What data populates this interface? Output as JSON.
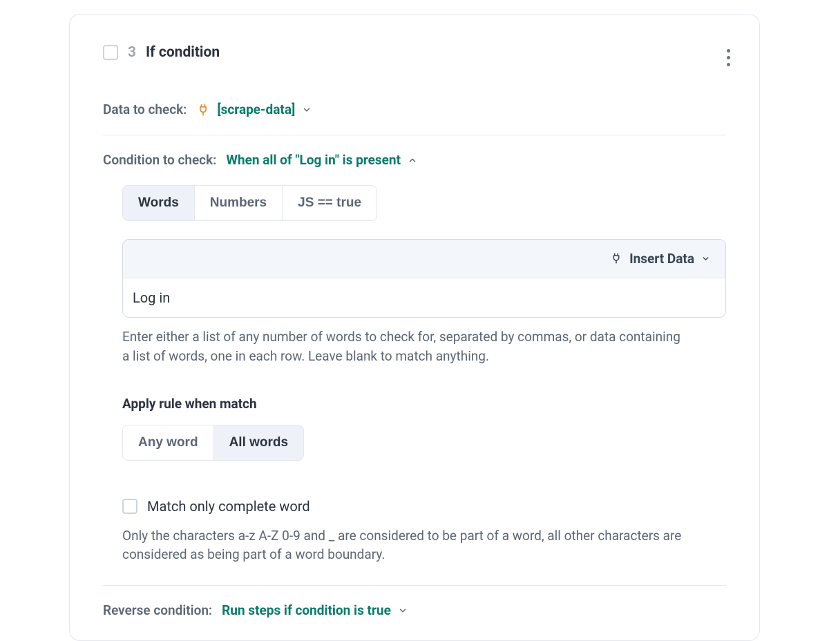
{
  "step": {
    "number": "3",
    "title": "If condition"
  },
  "data_to_check": {
    "label": "Data to check:",
    "value": "[scrape-data]"
  },
  "condition_to_check": {
    "label": "Condition to check:",
    "value": "When all of \"Log in\" is present"
  },
  "tabs": {
    "words": "Words",
    "numbers": "Numbers",
    "js": "JS == true"
  },
  "insert_data_label": "Insert Data",
  "words_input": "Log in",
  "words_help": "Enter either a list of any number of words to check for, separated by commas, or data containing a list of words, one in each row. Leave blank to match anything.",
  "apply_rule": {
    "label": "Apply rule when match",
    "any": "Any word",
    "all": "All words"
  },
  "complete_word": {
    "label": "Match only complete word",
    "help": "Only the characters a-z A-Z 0-9 and _ are considered to be part of a word, all other characters are considered as being part of a word boundary."
  },
  "reverse": {
    "label": "Reverse condition:",
    "value": "Run steps if condition is true"
  }
}
